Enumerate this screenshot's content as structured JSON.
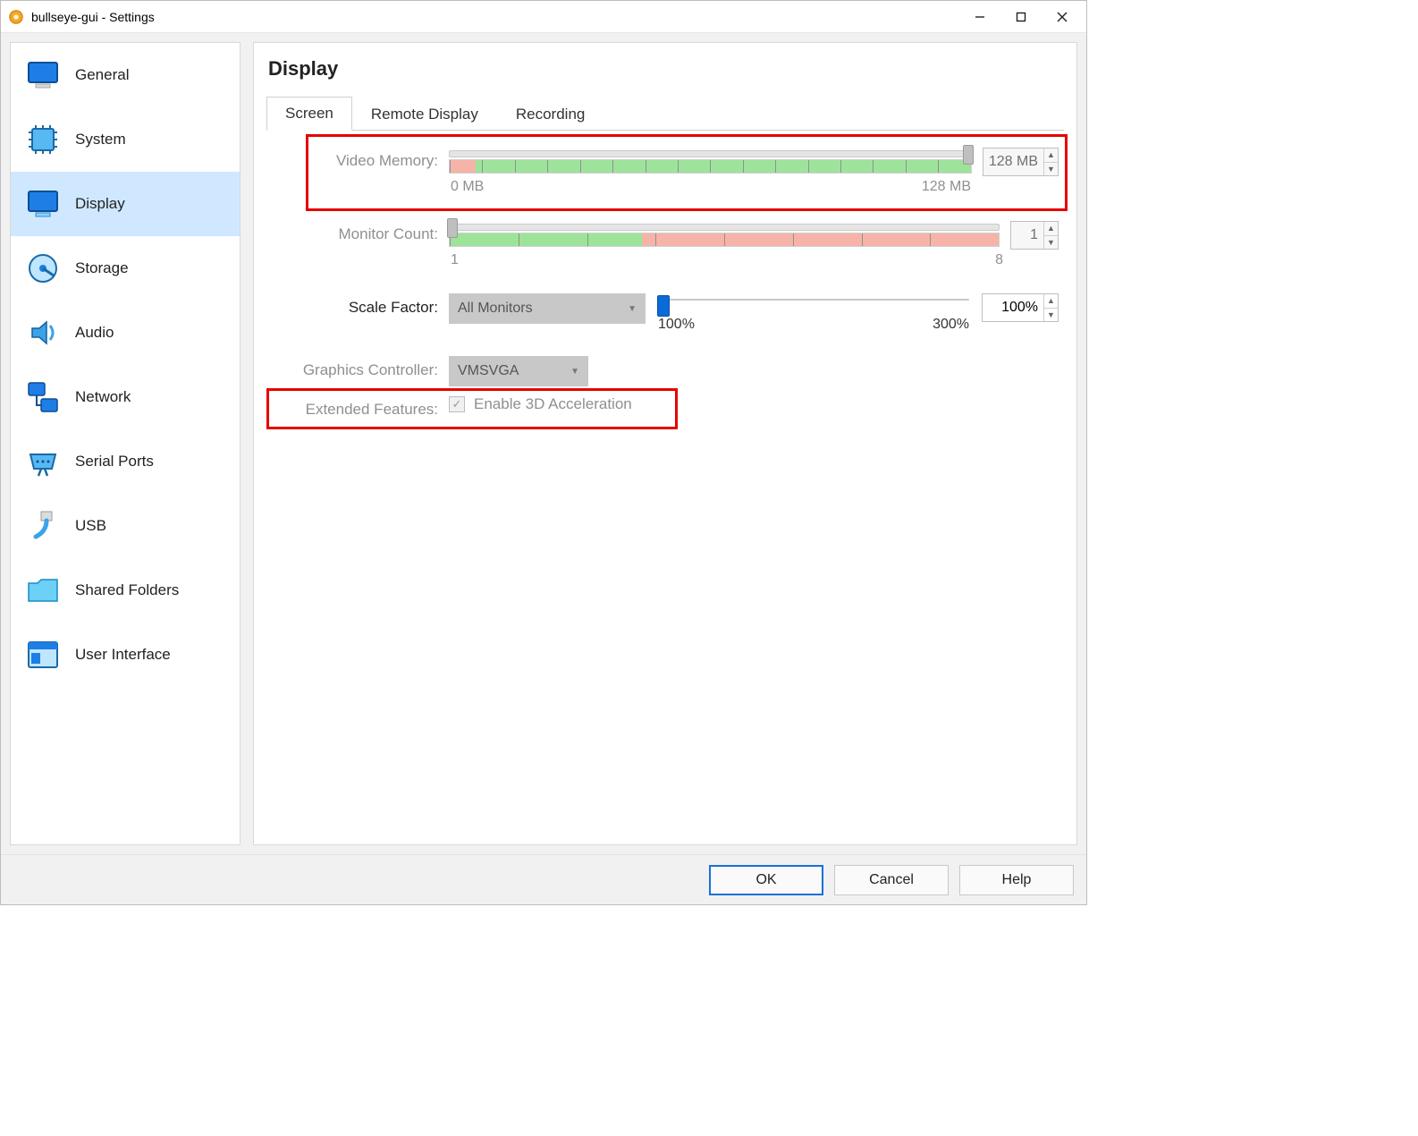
{
  "window": {
    "title": "bullseye-gui - Settings"
  },
  "sidebar": {
    "items": [
      {
        "label": "General"
      },
      {
        "label": "System"
      },
      {
        "label": "Display"
      },
      {
        "label": "Storage"
      },
      {
        "label": "Audio"
      },
      {
        "label": "Network"
      },
      {
        "label": "Serial Ports"
      },
      {
        "label": "USB"
      },
      {
        "label": "Shared Folders"
      },
      {
        "label": "User Interface"
      }
    ],
    "active_index": 2
  },
  "page": {
    "title": "Display"
  },
  "tabs": {
    "items": [
      "Screen",
      "Remote Display",
      "Recording"
    ],
    "active_index": 0
  },
  "video_memory": {
    "label": "Video Memory:",
    "value": "128 MB",
    "min_label": "0 MB",
    "max_label": "128 MB"
  },
  "monitor_count": {
    "label": "Monitor Count:",
    "value": "1",
    "min_label": "1",
    "max_label": "8"
  },
  "scale_factor": {
    "label": "Scale Factor:",
    "select_value": "All Monitors",
    "value": "100%",
    "min_label": "100%",
    "max_label": "300%"
  },
  "graphics_controller": {
    "label": "Graphics Controller:",
    "value": "VMSVGA"
  },
  "extended_features": {
    "label": "Extended Features:",
    "checkbox_label": "Enable 3D Acceleration",
    "checked": true
  },
  "footer": {
    "ok": "OK",
    "cancel": "Cancel",
    "help": "Help"
  }
}
